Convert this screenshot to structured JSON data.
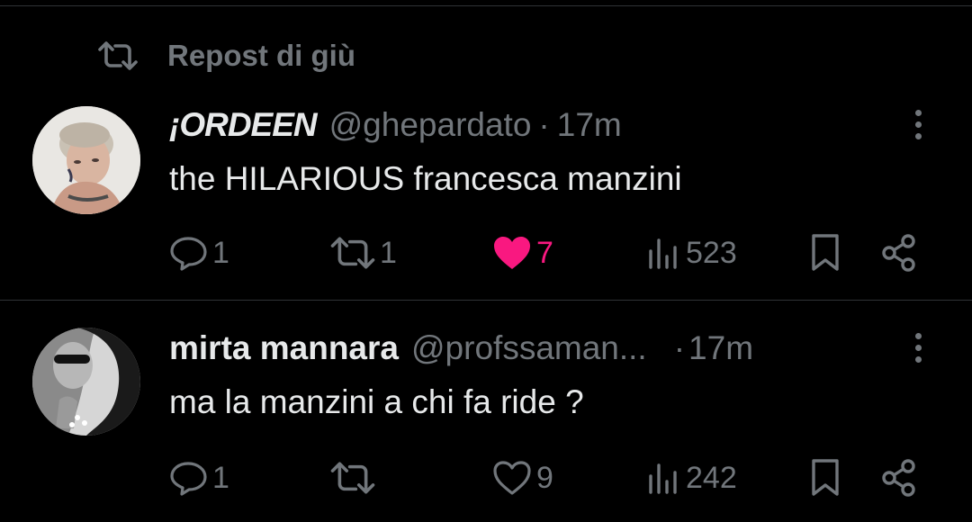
{
  "repost_context": {
    "label": "Repost di giù",
    "icon": "repost-icon"
  },
  "tweets": [
    {
      "display_name": "¡ORDEEN",
      "handle": "@ghepardato",
      "separator": "·",
      "time": "17m",
      "text": "the HILARIOUS francesca manzini",
      "replies": "1",
      "reposts": "1",
      "likes": "7",
      "liked": true,
      "views": "523"
    },
    {
      "display_name": "mirta mannara",
      "handle": "@profssaman...",
      "separator": "·",
      "time": "17m",
      "text": "ma la manzini a chi fa ride ?",
      "replies": "1",
      "reposts": "",
      "likes": "9",
      "liked": false,
      "views": "242"
    }
  ],
  "colors": {
    "background": "#000000",
    "text_primary": "#e7e9ea",
    "text_secondary": "#71767b",
    "like_active": "#f91880",
    "divider": "#2f3336"
  },
  "icons": [
    "repost-icon",
    "more-icon",
    "reply-icon",
    "like-icon",
    "views-icon",
    "bookmark-icon",
    "share-icon"
  ]
}
